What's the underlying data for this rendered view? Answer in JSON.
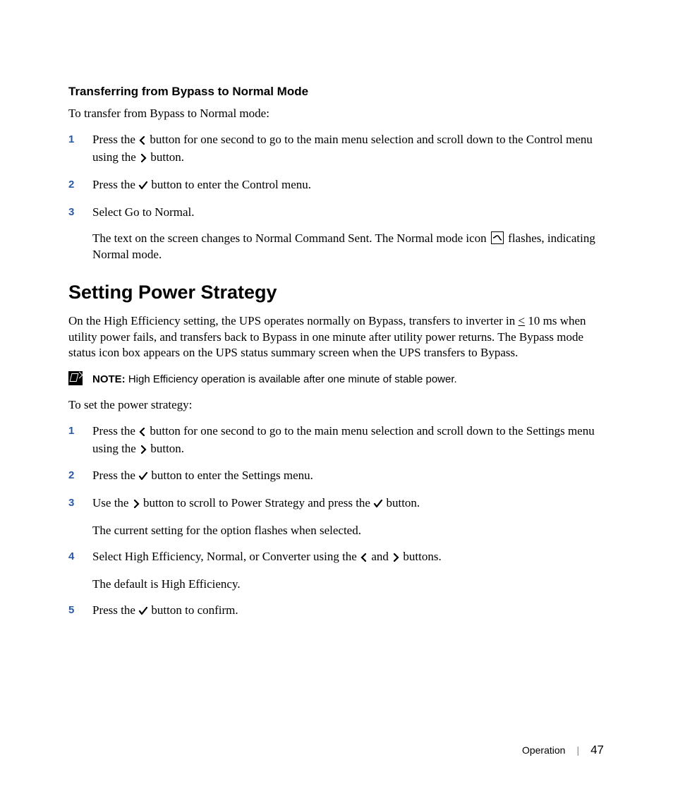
{
  "section1": {
    "heading": "Transferring from Bypass to Normal Mode",
    "intro": "To transfer from Bypass to Normal mode:",
    "steps": [
      {
        "num": "1",
        "pre": "Press the ",
        "mid": " button for one second to go to the main menu selection and scroll down to the Control menu using the ",
        "post": " button."
      },
      {
        "num": "2",
        "pre": "Press the ",
        "post": " button to enter the Control menu."
      },
      {
        "num": "3",
        "text": "Select Go to Normal.",
        "sub_pre": "The text on the screen changes to Normal Command Sent. The Normal mode icon ",
        "sub_post": " flashes, indicating Normal mode."
      }
    ]
  },
  "section2": {
    "title": "Setting Power Strategy",
    "para_pre": "On the High Efficiency setting, the UPS operates normally on Bypass, transfers to inverter in ",
    "para_lte": "<",
    "para_post": " 10 ms when utility power fails, and transfers back to Bypass in one minute after utility power returns. The Bypass mode status icon box appears on the UPS status summary screen when the UPS transfers to Bypass.",
    "note_label": "NOTE:",
    "note_text": " High Efficiency operation is available after one minute of stable power.",
    "intro": "To set the power strategy:",
    "steps": [
      {
        "num": "1",
        "pre": "Press the ",
        "mid": " button for one second to go to the main menu selection and scroll down to the Settings menu using the ",
        "post": " button."
      },
      {
        "num": "2",
        "pre": "Press the ",
        "post": " button to enter the Settings menu."
      },
      {
        "num": "3",
        "pre": "Use the ",
        "mid": " button to scroll to Power Strategy and press the ",
        "post": " button.",
        "sub": "The current setting for the option flashes when selected."
      },
      {
        "num": "4",
        "pre": "Select High Efficiency, Normal, or Converter using the ",
        "mid": " and ",
        "post": " buttons.",
        "sub": "The default is High Efficiency."
      },
      {
        "num": "5",
        "pre": "Press the ",
        "post": " button to confirm."
      }
    ]
  },
  "footer": {
    "section": "Operation",
    "page": "47"
  }
}
